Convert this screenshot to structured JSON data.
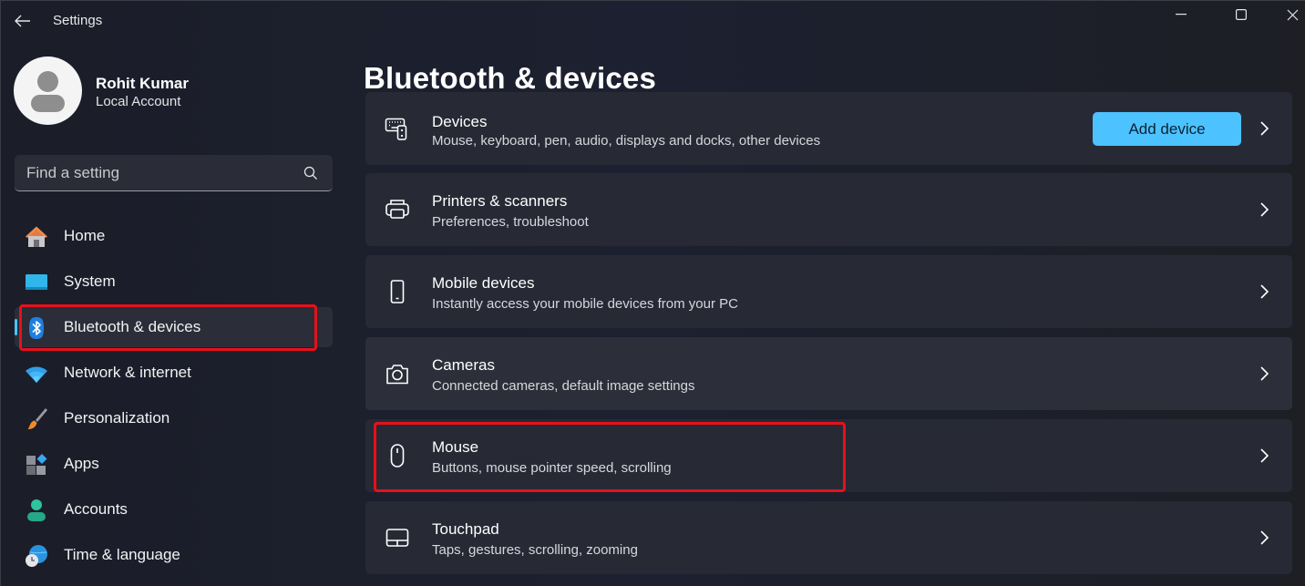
{
  "window": {
    "title": "Settings",
    "controls": {
      "minimize": "minimize",
      "maximize": "maximize",
      "close": "close"
    }
  },
  "user": {
    "name": "Rohit Kumar",
    "account_type": "Local Account"
  },
  "search": {
    "placeholder": "Find a setting"
  },
  "sidebar": {
    "items": [
      {
        "label": "Home",
        "icon": "home-icon"
      },
      {
        "label": "System",
        "icon": "system-icon"
      },
      {
        "label": "Bluetooth & devices",
        "icon": "bluetooth-icon",
        "active": true
      },
      {
        "label": "Network & internet",
        "icon": "wifi-icon"
      },
      {
        "label": "Personalization",
        "icon": "brush-icon"
      },
      {
        "label": "Apps",
        "icon": "apps-icon"
      },
      {
        "label": "Accounts",
        "icon": "account-icon"
      },
      {
        "label": "Time & language",
        "icon": "globe-clock-icon"
      }
    ]
  },
  "main": {
    "title": "Bluetooth & devices",
    "add_device_label": "Add device",
    "cards": [
      {
        "title": "Devices",
        "subtitle": "Mouse, keyboard, pen, audio, displays and docks, other devices",
        "icon": "devices-icon"
      },
      {
        "title": "Printers & scanners",
        "subtitle": "Preferences, troubleshoot",
        "icon": "printer-icon"
      },
      {
        "title": "Mobile devices",
        "subtitle": "Instantly access your mobile devices from your PC",
        "icon": "phone-icon"
      },
      {
        "title": "Cameras",
        "subtitle": "Connected cameras, default image settings",
        "icon": "camera-icon"
      },
      {
        "title": "Mouse",
        "subtitle": "Buttons, mouse pointer speed, scrolling",
        "icon": "mouse-icon",
        "highlighted": true
      },
      {
        "title": "Touchpad",
        "subtitle": "Taps, gestures, scrolling, zooming",
        "icon": "touchpad-icon"
      }
    ]
  },
  "colors": {
    "accent": "#4cc2ff",
    "highlight_annotation": "#e8101a"
  }
}
